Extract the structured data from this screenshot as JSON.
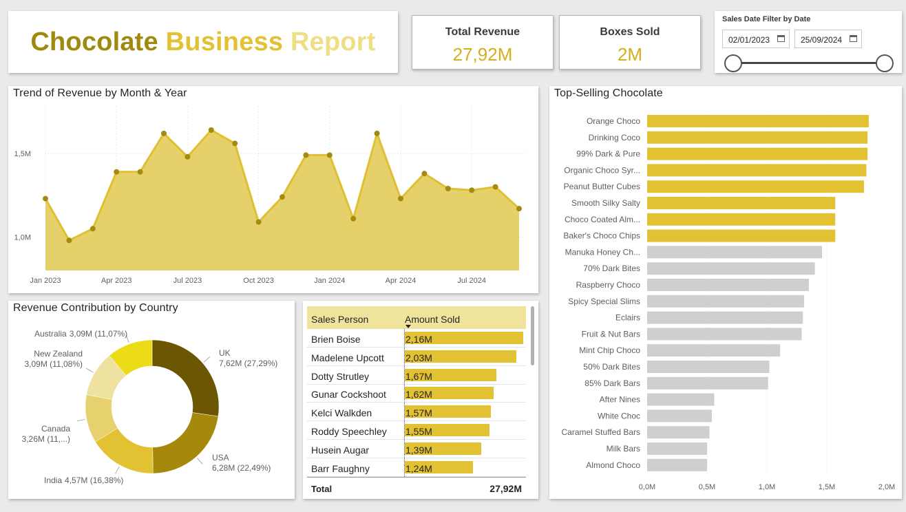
{
  "header": {
    "title_words": [
      "Chocolate",
      "Business",
      "Report"
    ]
  },
  "kpis": {
    "revenue_label": "Total Revenue",
    "revenue_value": "27,92M",
    "boxes_label": "Boxes Sold",
    "boxes_value": "2M"
  },
  "slicer": {
    "label": "Sales Date Filter by Date",
    "start_date": "02/01/2023",
    "end_date": "25/09/2024"
  },
  "colors": {
    "gold_dark": "#a08a0e",
    "gold": "#e2c233",
    "gold_light": "#eedf85",
    "grey_bar": "#cfcfcf",
    "area_fill": "#e6d06a",
    "line": "#e0bf31",
    "marker": "#a48a10"
  },
  "table": {
    "col_name": "Sales Person",
    "col_amount": "Amount Sold",
    "total_label": "Total",
    "total_value": "27,92M"
  },
  "chart_data": [
    {
      "type": "area",
      "title": "Trend of Revenue by Month & Year",
      "x": [
        "2023-01",
        "2023-02",
        "2023-03",
        "2023-04",
        "2023-05",
        "2023-06",
        "2023-07",
        "2023-08",
        "2023-09",
        "2023-10",
        "2023-11",
        "2023-12",
        "2024-01",
        "2024-02",
        "2024-03",
        "2024-04",
        "2024-05",
        "2024-06",
        "2024-07",
        "2024-08",
        "2024-09"
      ],
      "values": [
        1.23,
        0.98,
        1.05,
        1.39,
        1.39,
        1.62,
        1.48,
        1.64,
        1.56,
        1.09,
        1.24,
        1.49,
        1.49,
        1.11,
        1.62,
        1.23,
        1.38,
        1.29,
        1.28,
        1.3,
        1.17
      ],
      "x_ticks": [
        {
          "label": "Jan 2023",
          "index": 0
        },
        {
          "label": "Apr 2023",
          "index": 3
        },
        {
          "label": "Jul 2023",
          "index": 6
        },
        {
          "label": "Oct 2023",
          "index": 9
        },
        {
          "label": "Jan 2024",
          "index": 12
        },
        {
          "label": "Apr 2024",
          "index": 15
        },
        {
          "label": "Jul 2024",
          "index": 18
        }
      ],
      "y_ticks": [
        {
          "label": "1,0M",
          "value": 1.0
        },
        {
          "label": "1,5M",
          "value": 1.5
        }
      ],
      "ylim": [
        0.8,
        1.78
      ],
      "unit": "M",
      "grid": true
    },
    {
      "type": "pie",
      "title": "Revenue Contribution by Country",
      "slices": [
        {
          "name": "UK",
          "value": 7.62,
          "label": "7,62M (27,29%)",
          "color": "#6b5604"
        },
        {
          "name": "USA",
          "value": 6.28,
          "label": "6,28M (22,49%)",
          "color": "#a6880b"
        },
        {
          "name": "India",
          "value": 4.57,
          "label": "4,57M (16,38%)",
          "color": "#e2c233"
        },
        {
          "name": "Canada",
          "value": 3.26,
          "label": "3,26M (11,...)",
          "color": "#e7d06e"
        },
        {
          "name": "New Zealand",
          "value": 3.09,
          "label": "3,09M (11,08%)",
          "color": "#efe1a0"
        },
        {
          "name": "Australia",
          "value": 3.09,
          "label": "3,09M (11,07%)",
          "color": "#ecdc18"
        }
      ]
    },
    {
      "type": "table",
      "title": "Sales Person / Amount Sold",
      "rows": [
        {
          "name": "Brien Boise",
          "value": 2.16,
          "label": "2,16M"
        },
        {
          "name": "Madelene Upcott",
          "value": 2.03,
          "label": "2,03M"
        },
        {
          "name": "Dotty Strutley",
          "value": 1.67,
          "label": "1,67M"
        },
        {
          "name": "Gunar Cockshoot",
          "value": 1.62,
          "label": "1,62M"
        },
        {
          "name": "Kelci Walkden",
          "value": 1.57,
          "label": "1,57M"
        },
        {
          "name": "Roddy Speechley",
          "value": 1.55,
          "label": "1,55M"
        },
        {
          "name": "Husein Augar",
          "value": 1.39,
          "label": "1,39M"
        },
        {
          "name": "Barr Faughny",
          "value": 1.24,
          "label": "1,24M"
        }
      ]
    },
    {
      "type": "bar",
      "orientation": "horizontal",
      "title": "Top-Selling Chocolate",
      "categories": [
        "Orange Choco",
        "Drinking Coco",
        "99% Dark & Pure",
        "Organic Choco Syr...",
        "Peanut Butter Cubes",
        "Smooth Silky Salty",
        "Choco Coated Alm...",
        "Baker's Choco Chips",
        "Manuka Honey Ch...",
        "70% Dark Bites",
        "Raspberry Choco",
        "Spicy Special Slims",
        "Eclairs",
        "Fruit & Nut Bars",
        "Mint Chip Choco",
        "50% Dark Bites",
        "85% Dark Bars",
        "After Nines",
        "White Choc",
        "Caramel Stuffed Bars",
        "Milk Bars",
        "Almond Choco"
      ],
      "values": [
        1.85,
        1.84,
        1.84,
        1.83,
        1.81,
        1.57,
        1.57,
        1.57,
        1.46,
        1.4,
        1.35,
        1.31,
        1.3,
        1.29,
        1.11,
        1.02,
        1.01,
        0.56,
        0.54,
        0.52,
        0.5,
        0.5
      ],
      "highlight_count": 8,
      "x_ticks": [
        "0,0M",
        "0,5M",
        "1,0M",
        "1,5M",
        "2,0M"
      ],
      "xlim": [
        0,
        2.0
      ],
      "unit": "M"
    }
  ]
}
